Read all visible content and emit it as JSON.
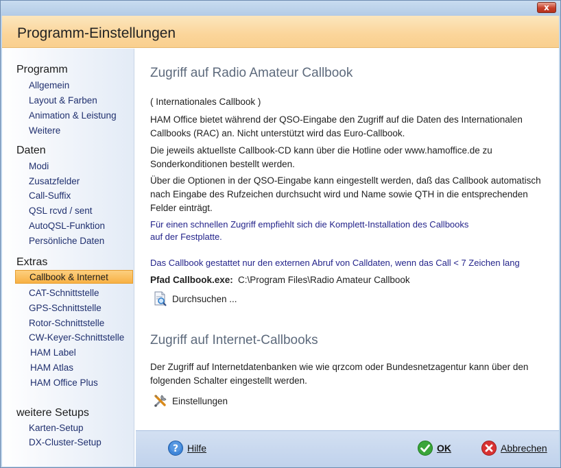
{
  "window": {
    "close_label": "x"
  },
  "header": {
    "title": "Programm-Einstellungen"
  },
  "sidebar": {
    "sections": [
      {
        "title": "Programm",
        "items": [
          "Allgemein",
          "Layout & Farben",
          "Animation & Leistung",
          "Weitere"
        ]
      },
      {
        "title": "Daten",
        "items": [
          "Modi",
          "Zusatzfelder",
          "Call-Suffix",
          "QSL rcvd / sent",
          "AutoQSL-Funktion",
          "Persönliche Daten"
        ]
      },
      {
        "title": "Extras",
        "items": [
          "Callbook & Internet",
          "CAT-Schnittstelle",
          "GPS-Schnittstelle",
          "Rotor-Schnittstelle",
          "CW-Keyer-Schnittstelle",
          "HAM Label",
          "HAM Atlas",
          "HAM Office Plus"
        ]
      },
      {
        "title": "weitere Setups",
        "items": [
          "Karten-Setup",
          "DX-Cluster-Setup"
        ]
      }
    ],
    "selected": "Callbook & Internet"
  },
  "main": {
    "section1": {
      "title": "Zugriff auf Radio Amateur Callbook",
      "subtitle": "( Internationales  Callbook )",
      "para1": "HAM Office bietet während der QSO-Eingabe den Zugriff auf die Daten des Internationalen Callbooks (RAC) an. Nicht unterstützt wird das Euro-Callbook.",
      "para2": "Die jeweils aktuellste Callbook-CD kann über die Hotline oder www.hamoffice.de zu Sonderkonditionen bestellt werden.",
      "para3": "Über die Optionen in der QSO-Eingabe kann eingestellt werden, daß das Callbook automatisch nach Eingabe des Rufzeichen durchsucht wird und Name sowie QTH in die entsprechenden Felder einträgt.",
      "note1": "Für einen schnellen Zugriff empfiehlt sich die Komplett-Installation des Callbooks auf der Festplatte.",
      "note2": "Das Callbook gestattet nur den externen Abruf von Calldaten, wenn das Call < 7 Zeichen lang",
      "path_label": "Pfad Callbook.exe:",
      "path_value": "C:\\Program Files\\Radio Amateur Callbook",
      "browse_label": "Durchsuchen ..."
    },
    "section2": {
      "title": "Zugriff auf Internet-Callbooks",
      "para": "Der Zugriff auf Internetdatenbanken wie wie qrzcom oder Bundesnetzagentur kann über den folgenden Schalter eingestellt werden.",
      "settings_label": "Einstellungen"
    }
  },
  "footer": {
    "help_label": "Hilfe",
    "ok_label": "OK",
    "cancel_label": "Abbrechen"
  },
  "colors": {
    "header": "#fbd59a",
    "active_item": "#f8b144",
    "footer": "#c8d8ef"
  }
}
